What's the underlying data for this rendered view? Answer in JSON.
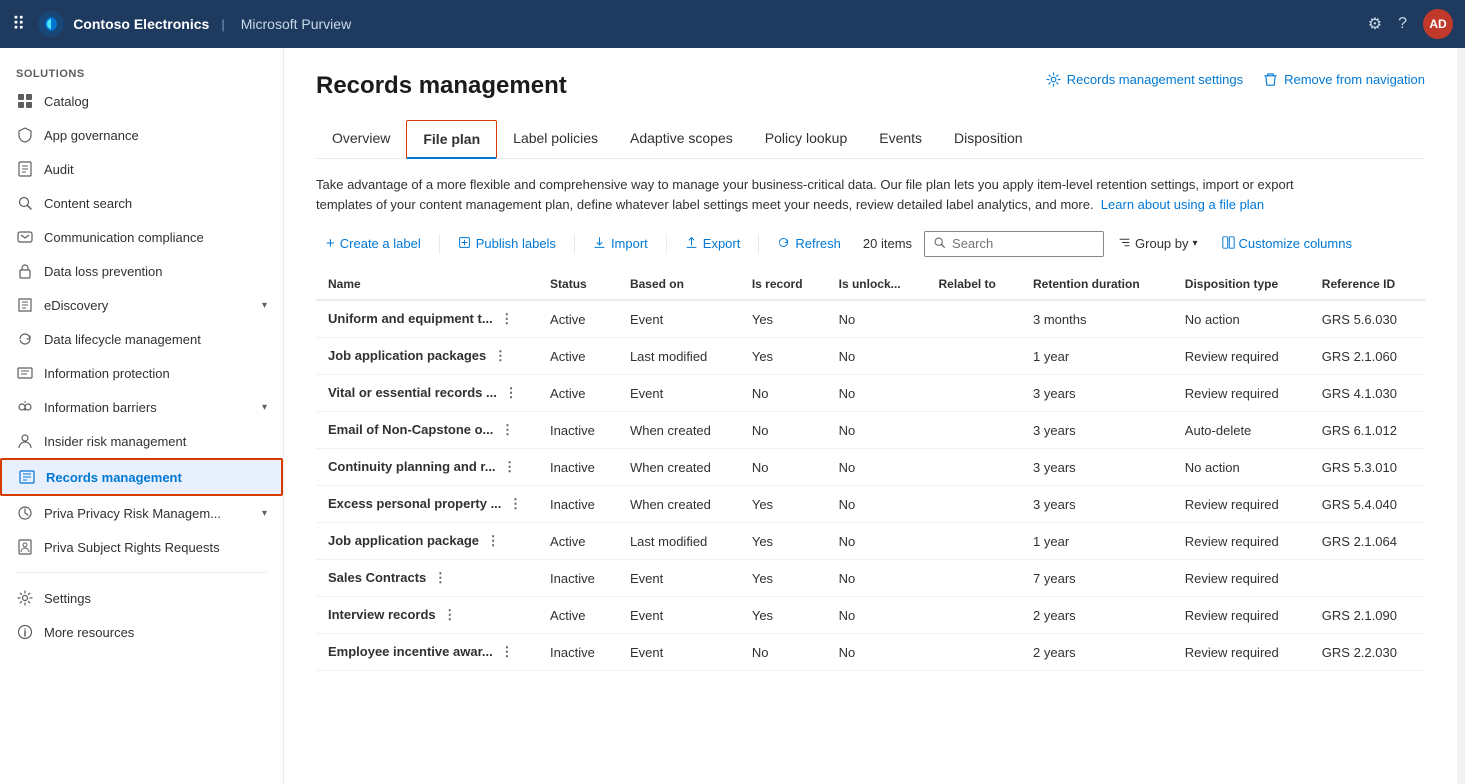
{
  "header": {
    "app_grid_icon": "⠿",
    "tenant_name": "Contoso Electronics",
    "app_name": "Microsoft Purview",
    "settings_icon": "⚙",
    "help_icon": "?",
    "avatar_initials": "AD"
  },
  "sidebar": {
    "section_label": "Solutions",
    "items": [
      {
        "id": "catalog",
        "label": "Catalog",
        "icon": "grid",
        "has_chevron": false,
        "active": false
      },
      {
        "id": "app-governance",
        "label": "App governance",
        "icon": "shield",
        "has_chevron": false,
        "active": false
      },
      {
        "id": "audit",
        "label": "Audit",
        "icon": "doc",
        "has_chevron": false,
        "active": false
      },
      {
        "id": "content-search",
        "label": "Content search",
        "icon": "search",
        "has_chevron": false,
        "active": false
      },
      {
        "id": "communication-compliance",
        "label": "Communication compliance",
        "icon": "chat",
        "has_chevron": false,
        "active": false
      },
      {
        "id": "data-loss-prevention",
        "label": "Data loss prevention",
        "icon": "lock",
        "has_chevron": false,
        "active": false
      },
      {
        "id": "ediscovery",
        "label": "eDiscovery",
        "icon": "folder",
        "has_chevron": true,
        "active": false
      },
      {
        "id": "data-lifecycle-management",
        "label": "Data lifecycle management",
        "icon": "cycle",
        "has_chevron": false,
        "active": false
      },
      {
        "id": "information-protection",
        "label": "Information protection",
        "icon": "info",
        "has_chevron": false,
        "active": false
      },
      {
        "id": "information-barriers",
        "label": "Information barriers",
        "icon": "barrier",
        "has_chevron": true,
        "active": false
      },
      {
        "id": "insider-risk-management",
        "label": "Insider risk management",
        "icon": "person",
        "has_chevron": false,
        "active": false
      },
      {
        "id": "records-management",
        "label": "Records management",
        "icon": "records",
        "has_chevron": false,
        "active": true
      },
      {
        "id": "priva-privacy",
        "label": "Priva Privacy Risk Managem...",
        "icon": "priva",
        "has_chevron": true,
        "active": false
      },
      {
        "id": "priva-subject",
        "label": "Priva Subject Rights Requests",
        "icon": "priva2",
        "has_chevron": false,
        "active": false
      }
    ],
    "bottom_items": [
      {
        "id": "settings",
        "label": "Settings",
        "icon": "gear"
      },
      {
        "id": "more-resources",
        "label": "More resources",
        "icon": "info2"
      }
    ]
  },
  "page": {
    "title": "Records management",
    "settings_link": "Records management settings",
    "nav_link": "Remove from navigation",
    "description": "Take advantage of a more flexible and comprehensive way to manage your business-critical data. Our file plan lets you apply item-level retention settings, import or export templates of your content management plan, define whatever label settings meet your needs, review detailed label analytics, and more.",
    "learn_link": "Learn about using a file plan",
    "tabs": [
      {
        "id": "overview",
        "label": "Overview",
        "active": false
      },
      {
        "id": "file-plan",
        "label": "File plan",
        "active": true
      },
      {
        "id": "label-policies",
        "label": "Label policies",
        "active": false
      },
      {
        "id": "adaptive-scopes",
        "label": "Adaptive scopes",
        "active": false
      },
      {
        "id": "policy-lookup",
        "label": "Policy lookup",
        "active": false
      },
      {
        "id": "events",
        "label": "Events",
        "active": false
      },
      {
        "id": "disposition",
        "label": "Disposition",
        "active": false
      }
    ],
    "toolbar": {
      "create_label": "Create a label",
      "publish_labels": "Publish labels",
      "import": "Import",
      "export": "Export",
      "refresh": "Refresh",
      "item_count": "20 items",
      "search_placeholder": "Search",
      "group_by": "Group by",
      "customize_columns": "Customize columns"
    },
    "table": {
      "columns": [
        "Name",
        "Status",
        "Based on",
        "Is record",
        "Is unlock...",
        "Relabel to",
        "Retention duration",
        "Disposition type",
        "Reference ID"
      ],
      "rows": [
        {
          "name": "Uniform and equipment t...",
          "status": "Active",
          "based_on": "Event",
          "is_record": "Yes",
          "is_unlock": "No",
          "relabel_to": "",
          "retention_duration": "3 months",
          "disposition_type": "No action",
          "reference_id": "GRS 5.6.030"
        },
        {
          "name": "Job application packages",
          "status": "Active",
          "based_on": "Last modified",
          "is_record": "Yes",
          "is_unlock": "No",
          "relabel_to": "",
          "retention_duration": "1 year",
          "disposition_type": "Review required",
          "reference_id": "GRS 2.1.060"
        },
        {
          "name": "Vital or essential records ...",
          "status": "Active",
          "based_on": "Event",
          "is_record": "No",
          "is_unlock": "No",
          "relabel_to": "",
          "retention_duration": "3 years",
          "disposition_type": "Review required",
          "reference_id": "GRS 4.1.030"
        },
        {
          "name": "Email of Non-Capstone o...",
          "status": "Inactive",
          "based_on": "When created",
          "is_record": "No",
          "is_unlock": "No",
          "relabel_to": "",
          "retention_duration": "3 years",
          "disposition_type": "Auto-delete",
          "reference_id": "GRS 6.1.012"
        },
        {
          "name": "Continuity planning and r...",
          "status": "Inactive",
          "based_on": "When created",
          "is_record": "No",
          "is_unlock": "No",
          "relabel_to": "",
          "retention_duration": "3 years",
          "disposition_type": "No action",
          "reference_id": "GRS 5.3.010"
        },
        {
          "name": "Excess personal property ...",
          "status": "Inactive",
          "based_on": "When created",
          "is_record": "Yes",
          "is_unlock": "No",
          "relabel_to": "",
          "retention_duration": "3 years",
          "disposition_type": "Review required",
          "reference_id": "GRS 5.4.040"
        },
        {
          "name": "Job application package",
          "status": "Active",
          "based_on": "Last modified",
          "is_record": "Yes",
          "is_unlock": "No",
          "relabel_to": "",
          "retention_duration": "1 year",
          "disposition_type": "Review required",
          "reference_id": "GRS 2.1.064"
        },
        {
          "name": "Sales Contracts",
          "status": "Inactive",
          "based_on": "Event",
          "is_record": "Yes",
          "is_unlock": "No",
          "relabel_to": "",
          "retention_duration": "7 years",
          "disposition_type": "Review required",
          "reference_id": ""
        },
        {
          "name": "Interview records",
          "status": "Active",
          "based_on": "Event",
          "is_record": "Yes",
          "is_unlock": "No",
          "relabel_to": "",
          "retention_duration": "2 years",
          "disposition_type": "Review required",
          "reference_id": "GRS 2.1.090"
        },
        {
          "name": "Employee incentive awar...",
          "status": "Inactive",
          "based_on": "Event",
          "is_record": "No",
          "is_unlock": "No",
          "relabel_to": "",
          "retention_duration": "2 years",
          "disposition_type": "Review required",
          "reference_id": "GRS 2.2.030"
        }
      ]
    }
  }
}
